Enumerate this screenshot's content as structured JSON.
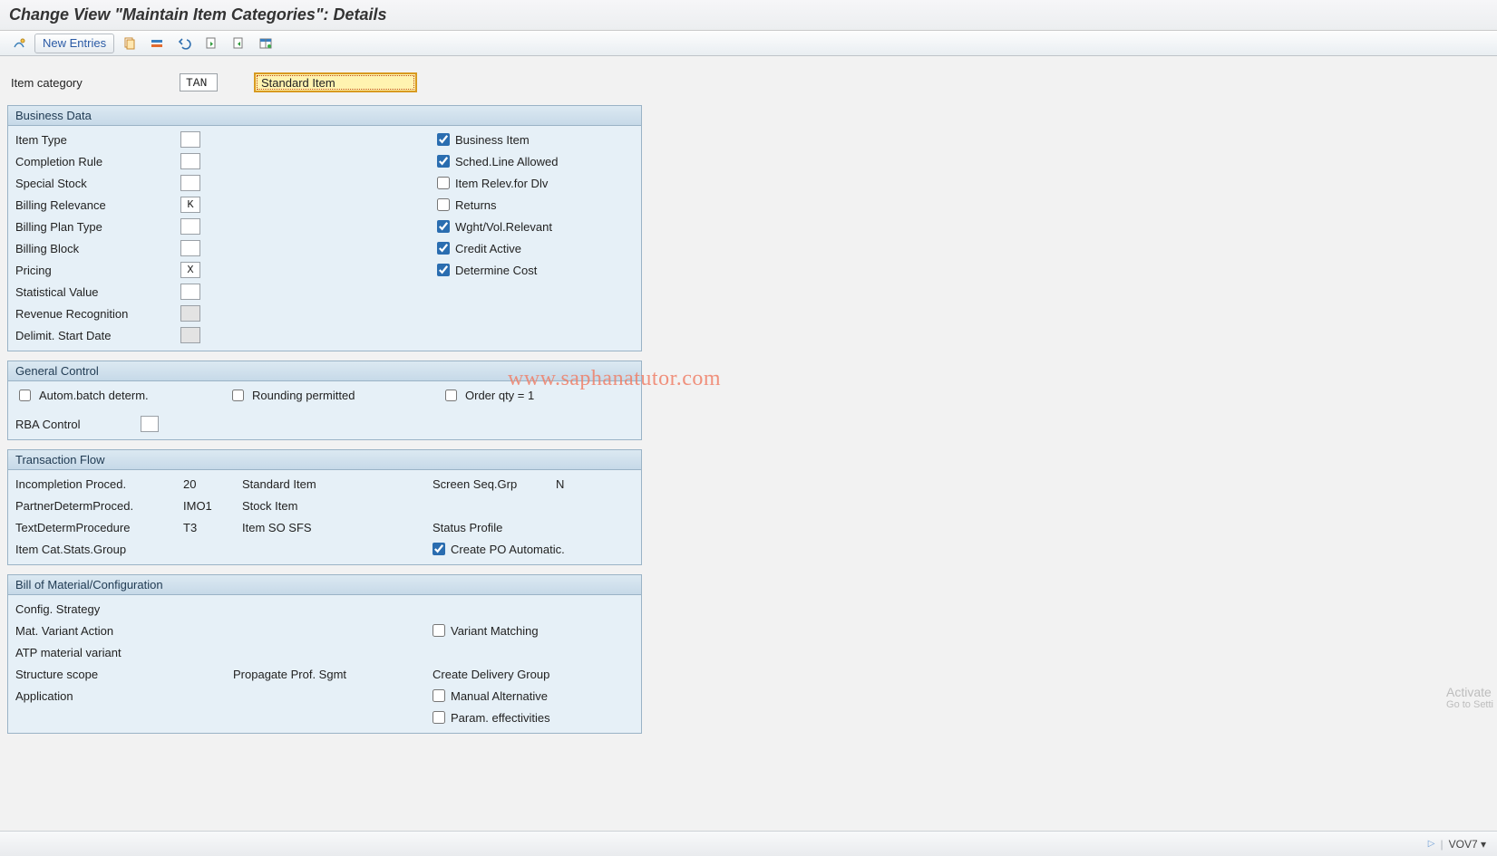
{
  "title": "Change View \"Maintain Item Categories\": Details",
  "toolbar": {
    "new_entries": "New Entries"
  },
  "header": {
    "label": "Item category",
    "code": "TAN",
    "description": "Standard Item"
  },
  "business_data": {
    "title": "Business Data",
    "left": {
      "item_type": {
        "label": "Item Type",
        "value": ""
      },
      "completion_rule": {
        "label": "Completion Rule",
        "value": ""
      },
      "special_stock": {
        "label": "Special Stock",
        "value": ""
      },
      "billing_relevance": {
        "label": "Billing Relevance",
        "value": "K"
      },
      "billing_plan_type": {
        "label": "Billing Plan Type",
        "value": ""
      },
      "billing_block": {
        "label": "Billing Block",
        "value": ""
      },
      "pricing": {
        "label": "Pricing",
        "value": "X"
      },
      "statistical_value": {
        "label": "Statistical Value",
        "value": ""
      },
      "revenue_recognition": {
        "label": "Revenue Recognition",
        "value": ""
      },
      "delimit_start_date": {
        "label": "Delimit. Start Date",
        "value": ""
      }
    },
    "right": {
      "business_item": {
        "label": "Business Item",
        "checked": true
      },
      "sched_line_allowed": {
        "label": "Sched.Line Allowed",
        "checked": true
      },
      "item_relev_dlv": {
        "label": "Item Relev.for Dlv",
        "checked": false
      },
      "returns": {
        "label": "Returns",
        "checked": false
      },
      "wght_vol_relevant": {
        "label": "Wght/Vol.Relevant",
        "checked": true
      },
      "credit_active": {
        "label": "Credit Active",
        "checked": true
      },
      "determine_cost": {
        "label": "Determine Cost",
        "checked": true
      }
    }
  },
  "general_control": {
    "title": "General Control",
    "autom_batch": {
      "label": "Autom.batch determ.",
      "checked": false
    },
    "rounding": {
      "label": "Rounding permitted",
      "checked": false
    },
    "order_qty1": {
      "label": "Order qty = 1",
      "checked": false
    },
    "rba_control": {
      "label": "RBA Control",
      "value": ""
    }
  },
  "transaction_flow": {
    "title": "Transaction Flow",
    "incompletion_proced": {
      "label": "Incompletion Proced.",
      "value": "20",
      "desc": "Standard Item"
    },
    "partner_determ_proced": {
      "label": "PartnerDetermProced.",
      "value": "IMO1",
      "desc": "Stock Item"
    },
    "text_determ_procedure": {
      "label": "TextDetermProcedure",
      "value": "T3",
      "desc": "Item SO SFS"
    },
    "item_cat_stats_group": {
      "label": "Item Cat.Stats.Group",
      "value": ""
    },
    "screen_seq_grp": {
      "label": "Screen Seq.Grp",
      "value": "N"
    },
    "status_profile": {
      "label": "Status Profile",
      "value": ""
    },
    "create_po_auto": {
      "label": "Create PO Automatic.",
      "checked": true
    }
  },
  "bom": {
    "title": "Bill of Material/Configuration",
    "config_strategy": {
      "label": "Config. Strategy",
      "value": ""
    },
    "mat_variant_action": {
      "label": "Mat. Variant Action",
      "value": ""
    },
    "atp_material_variant": {
      "label": "ATP material variant",
      "value": ""
    },
    "structure_scope": {
      "label": "Structure scope",
      "value": ""
    },
    "application": {
      "label": "Application",
      "value": ""
    },
    "propagate_prof_sgmt": {
      "label": "Propagate Prof. Sgmt",
      "value": ""
    },
    "variant_matching": {
      "label": "Variant Matching",
      "checked": false
    },
    "create_delivery_group": {
      "label": "Create Delivery Group",
      "value": ""
    },
    "manual_alternative": {
      "label": "Manual Alternative",
      "checked": false
    },
    "param_effectivities": {
      "label": "Param. effectivities",
      "checked": false
    }
  },
  "watermark": "www.saphanatutor.com",
  "footer": {
    "tcode": "VOV7"
  },
  "activate": {
    "line1": "Activate",
    "line2": "Go to Setti"
  }
}
